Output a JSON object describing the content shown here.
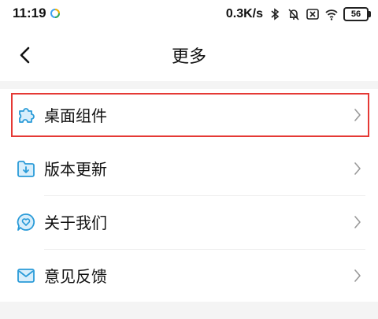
{
  "status_bar": {
    "time": "11:19",
    "net_speed": "0.3K/s",
    "battery": "56"
  },
  "header": {
    "title": "更多",
    "back_icon": "chevron-left-icon"
  },
  "menu": {
    "items": [
      {
        "label": "桌面组件",
        "icon": "puzzle-icon",
        "highlighted": true
      },
      {
        "label": "版本更新",
        "icon": "download-folder-icon",
        "highlighted": false
      },
      {
        "label": "关于我们",
        "icon": "heart-chat-icon",
        "highlighted": false
      },
      {
        "label": "意见反馈",
        "icon": "mail-icon",
        "highlighted": false
      }
    ]
  },
  "colors": {
    "accent": "#2a9bd8",
    "highlight_border": "#e53935",
    "page_background": "#f4f4f4"
  }
}
